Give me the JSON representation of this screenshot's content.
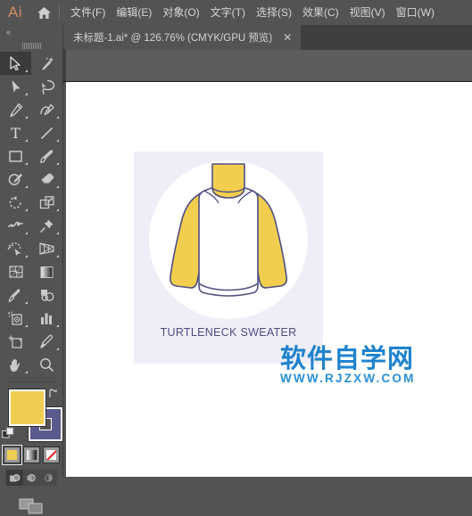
{
  "app": {
    "logo_text": "Ai",
    "home_icon": "home-icon"
  },
  "menubar": {
    "items": [
      {
        "label": "文件(F)",
        "name": "menu-file"
      },
      {
        "label": "编辑(E)",
        "name": "menu-edit"
      },
      {
        "label": "对象(O)",
        "name": "menu-object"
      },
      {
        "label": "文字(T)",
        "name": "menu-type"
      },
      {
        "label": "选择(S)",
        "name": "menu-select"
      },
      {
        "label": "效果(C)",
        "name": "menu-effect"
      },
      {
        "label": "视图(V)",
        "name": "menu-view"
      },
      {
        "label": "窗口(W)",
        "name": "menu-window"
      }
    ]
  },
  "tab": {
    "title": "未标题-1.ai* @ 126.76% (CMYK/GPU 预览)",
    "close_label": "✕"
  },
  "toolpanel": {
    "collapse_label": "«",
    "tools": [
      {
        "name": "selection-tool",
        "icon": "selection-arrow-icon",
        "selected": true,
        "has_flyout": true
      },
      {
        "name": "magic-wand-tool",
        "icon": "magic-wand-icon",
        "selected": false,
        "has_flyout": false
      },
      {
        "name": "direct-selection-tool",
        "icon": "direct-selection-arrow-icon",
        "selected": false,
        "has_flyout": true
      },
      {
        "name": "lasso-tool",
        "icon": "lasso-icon",
        "selected": false,
        "has_flyout": false
      },
      {
        "name": "pen-tool",
        "icon": "pen-icon",
        "selected": false,
        "has_flyout": true
      },
      {
        "name": "curvature-tool",
        "icon": "curvature-icon",
        "selected": false,
        "has_flyout": true
      },
      {
        "name": "type-tool",
        "icon": "type-t-icon",
        "selected": false,
        "has_flyout": true
      },
      {
        "name": "line-segment-tool",
        "icon": "line-segment-icon",
        "selected": false,
        "has_flyout": true
      },
      {
        "name": "rectangle-tool",
        "icon": "rectangle-icon",
        "selected": false,
        "has_flyout": true
      },
      {
        "name": "paintbrush-tool",
        "icon": "paintbrush-icon",
        "selected": false,
        "has_flyout": true
      },
      {
        "name": "shaper-tool",
        "icon": "shaper-pencil-icon",
        "selected": false,
        "has_flyout": true
      },
      {
        "name": "eraser-tool",
        "icon": "eraser-icon",
        "selected": false,
        "has_flyout": true
      },
      {
        "name": "rotate-tool",
        "icon": "rotate-icon",
        "selected": false,
        "has_flyout": true
      },
      {
        "name": "scale-tool",
        "icon": "scale-icon",
        "selected": false,
        "has_flyout": true
      },
      {
        "name": "width-tool",
        "icon": "width-warp-icon",
        "selected": false,
        "has_flyout": true
      },
      {
        "name": "free-transform-tool",
        "icon": "pushpin-icon",
        "selected": false,
        "has_flyout": true
      },
      {
        "name": "shape-builder-tool",
        "icon": "shape-builder-icon",
        "selected": false,
        "has_flyout": true
      },
      {
        "name": "perspective-grid-tool",
        "icon": "perspective-grid-icon",
        "selected": false,
        "has_flyout": true
      },
      {
        "name": "mesh-tool",
        "icon": "mesh-icon",
        "selected": false,
        "has_flyout": false
      },
      {
        "name": "gradient-tool",
        "icon": "gradient-icon",
        "selected": false,
        "has_flyout": false
      },
      {
        "name": "eyedropper-tool",
        "icon": "eyedropper-icon",
        "selected": false,
        "has_flyout": true
      },
      {
        "name": "blend-tool",
        "icon": "blend-icon",
        "selected": false,
        "has_flyout": false
      },
      {
        "name": "symbol-sprayer-tool",
        "icon": "symbol-sprayer-icon",
        "selected": false,
        "has_flyout": true
      },
      {
        "name": "column-graph-tool",
        "icon": "bar-graph-icon",
        "selected": false,
        "has_flyout": true
      },
      {
        "name": "artboard-tool",
        "icon": "artboard-icon",
        "selected": false,
        "has_flyout": false
      },
      {
        "name": "slice-tool",
        "icon": "slice-knife-icon",
        "selected": false,
        "has_flyout": true
      },
      {
        "name": "hand-tool",
        "icon": "hand-icon",
        "selected": false,
        "has_flyout": true
      },
      {
        "name": "zoom-tool",
        "icon": "magnifier-icon",
        "selected": false,
        "has_flyout": false
      }
    ],
    "color": {
      "fill_color": "#efce52",
      "stroke_color": "#5a5a8c",
      "swap_icon": "swap-fill-stroke-icon",
      "default_icon": "default-fill-stroke-icon",
      "fill_modes": [
        {
          "name": "color-fill-button",
          "icon": "solid-color-icon",
          "active": true
        },
        {
          "name": "gradient-fill-button",
          "icon": "gradient-swatch-icon",
          "active": false
        },
        {
          "name": "none-fill-button",
          "icon": "none-swatch-icon",
          "active": false
        }
      ],
      "draw_modes": [
        {
          "name": "draw-normal-button",
          "icon": "draw-normal-icon",
          "active": true
        },
        {
          "name": "draw-behind-button",
          "icon": "draw-behind-icon",
          "active": false
        },
        {
          "name": "draw-inside-button",
          "icon": "draw-inside-icon",
          "active": false
        }
      ],
      "screen_mode": {
        "name": "change-screen-mode-button",
        "icon": "screen-mode-icon"
      }
    }
  },
  "artwork": {
    "caption": "TURTLENECK SWEATER",
    "card_bg": "#efeef7",
    "circle_bg": "#ffffff",
    "sleeve_color": "#f2ce4f",
    "body_color": "#ffffff",
    "outline_color": "#4f4f82",
    "caption_color": "#4c4c80"
  },
  "watermark": {
    "cn_text": "软件自学网",
    "en_text": "WWW.RJZXW.COM",
    "color": "#1f83cd"
  }
}
